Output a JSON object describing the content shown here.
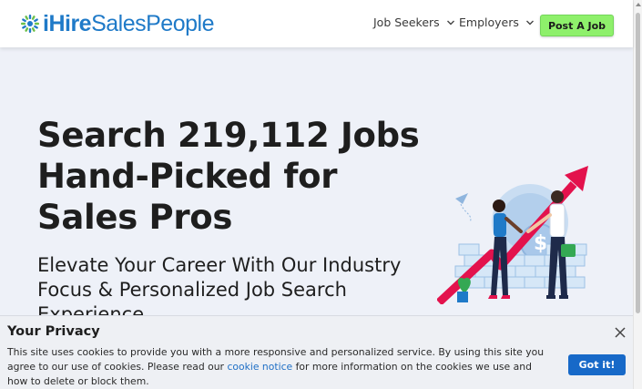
{
  "header": {
    "logo_brand": "iHire",
    "logo_sub": "SalesPeople",
    "nav": {
      "job_seekers": "Job Seekers",
      "employers": "Employers"
    },
    "post_job": "Post A Job"
  },
  "hero": {
    "title": "Search 219,112 Jobs Hand-Picked for Sales Pros",
    "subtitle": "Elevate Your Career With Our Industry Focus & Personalized Job Search Experience"
  },
  "cookie_banner": {
    "title": "Your Privacy",
    "text_before": "This site uses cookies to provide you with a more responsive and personalized service. By using this site you agree to our use of cookies. Please read our ",
    "link": "cookie notice",
    "text_after": " for more information on the cookies we use and how to delete or block them.",
    "accept": "Got it!"
  },
  "colors": {
    "brand_blue": "#1f7ac8",
    "post_button": "#8ef06b",
    "accept_button": "#1769c8",
    "hero_bg": "#eef1f8"
  },
  "icons": [
    "logo-mark-icon",
    "chevron-down-icon",
    "close-icon",
    "handshake-illustration"
  ]
}
